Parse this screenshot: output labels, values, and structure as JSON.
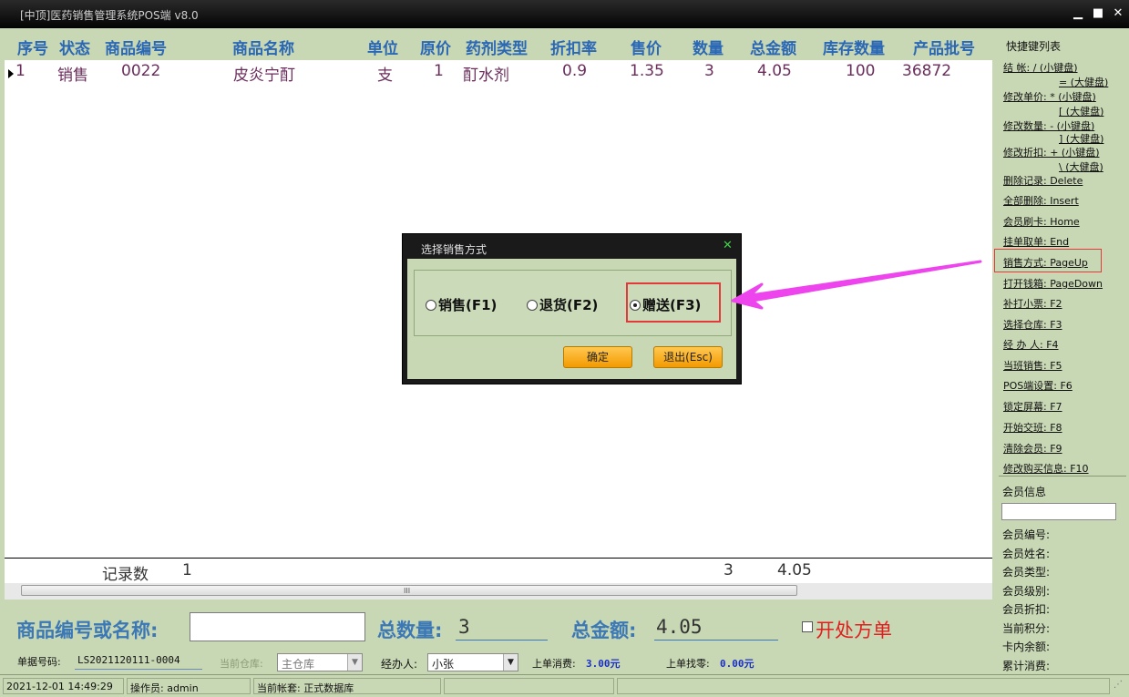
{
  "window": {
    "title": "[中顶]医药销售管理系统POS端 v8.0",
    "min": "▁",
    "max": "■",
    "close": "✕"
  },
  "grid": {
    "columns": [
      "序号",
      "状态",
      "商品编号",
      "商品名称",
      "单位",
      "原价",
      "药剂类型",
      "折扣率",
      "售价",
      "数量",
      "总金额",
      "库存数量",
      "产品批号"
    ],
    "rows": [
      [
        "1",
        "销售",
        "0022",
        "皮炎宁酊",
        "支",
        "1",
        "酊水剂",
        "0.9",
        "1.35",
        "3",
        "4.05",
        "100",
        "36872"
      ]
    ],
    "footer": {
      "label": "记录数",
      "count": "1",
      "qty": "3",
      "amount": "4.05"
    },
    "scroll_grip": "III"
  },
  "input_bar": {
    "code_label": "商品编号或名称:",
    "code_value": "",
    "qty_label": "总数量:",
    "qty_value": "3",
    "amount_label": "总金额:",
    "amount_value": "4.05",
    "open_label": "开处方单"
  },
  "status1": {
    "doc_label": "单据号码:",
    "doc_value": "LS2021120111-0004",
    "warehouse_label": "当前仓库:",
    "warehouse_value": "主仓库",
    "handler_label": "经办人:",
    "handler_value": "小张",
    "last_spend_label": "上单消费:",
    "last_spend_value": "3.00元",
    "last_change_label": "上单找零:",
    "last_change_value": "0.00元"
  },
  "status2": {
    "datetime": "2021-12-01 14:49:29",
    "operator": "操作员: admin",
    "account": "当前帐套: 正式数据库"
  },
  "sidebar": {
    "title": "快捷键列表",
    "shortcuts": {
      "checkout": "结    帐: / (小键盘)",
      "checkout2": "= (大健盘)",
      "price": "修改单价: * (小键盘)",
      "price2": "[ (大健盘)",
      "qty": "修改数量: - (小键盘)",
      "qty2": "] (大健盘)",
      "discount": "修改折扣: + (小键盘)",
      "discount2": "\\ (大健盘)",
      "delete": "删除记录: Delete",
      "delete_all": "全部删除: Insert",
      "card": "会员刷卡: Home",
      "hang": "挂单取单: End",
      "sale_mode": "销售方式: PageUp",
      "drawer": "打开钱箱: PageDown",
      "reprint": "补打小票: F2",
      "warehouse": "选择仓库: F3",
      "handler": "经 办 人: F4",
      "shift_sales": "当班销售: F5",
      "pos_settings": "POS端设置: F6",
      "lock": "锁定屏幕: F7",
      "handover": "开始交班: F8",
      "clear_member": "清除会员: F9",
      "edit_buyer": "修改购买信息: F10"
    },
    "member": {
      "title": "会员信息",
      "input": "",
      "fields": [
        "会员编号:",
        "会员姓名:",
        "会员类型:",
        "会员级别:",
        "会员折扣:",
        "当前积分:",
        "卡内余额:",
        "累计消费:"
      ]
    }
  },
  "dialog": {
    "title": "选择销售方式",
    "close": "✕",
    "options": [
      "销售(F1)",
      "退货(F2)",
      "赠送(F3)"
    ],
    "selected": 2,
    "ok": "确定",
    "exit": "退出(Esc)"
  },
  "colors": {
    "accent": "#3b78b5",
    "row_text": "#6b2d5c",
    "highlight": "#e23a3a",
    "arrow": "#ee44ee",
    "button": "#f7a800"
  }
}
